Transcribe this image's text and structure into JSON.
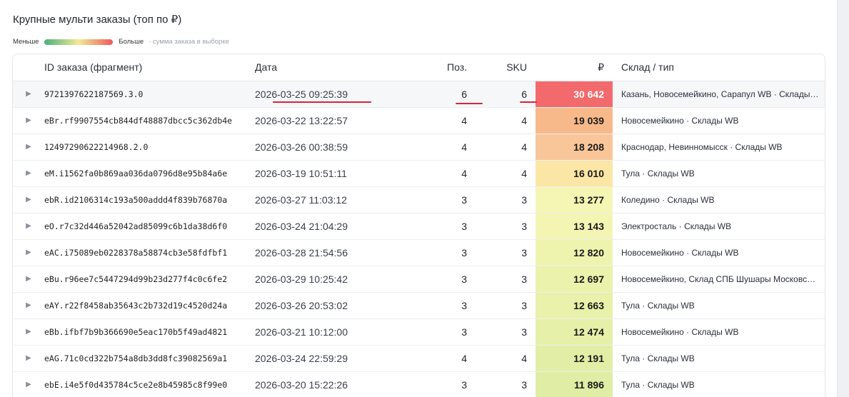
{
  "title": "Крупные мульти заказы (топ по ₽)",
  "legend": {
    "less": "Меньше",
    "more": "Больше",
    "hint": "· сумма заказа в выборке",
    "gradient_from": "#4caf7d",
    "gradient_mid": "#f2ea95",
    "gradient_to": "#ee5a5a"
  },
  "columns": {
    "id": "ID заказа (фрагмент)",
    "date": "Дата",
    "pos": "Поз.",
    "sku": "SKU",
    "rub": "₽",
    "warehouse": "Склад / тип"
  },
  "icons": {
    "expand": "play-triangle-icon"
  },
  "rows": [
    {
      "id": "9721397622187569.3.0",
      "date": "2026-03-25 09:25:39",
      "pos": "6",
      "sku": "6",
      "rub": "30 642",
      "warehouse": "Казань, Новосемейкино, Сарапул WB · Склады WB",
      "color": "#f36a6d"
    },
    {
      "id": "eBr.rf9907554cb844df48887dbcc5c362db4e",
      "date": "2026-03-22 13:22:57",
      "pos": "4",
      "sku": "4",
      "rub": "19 039",
      "warehouse": "Новосемейкино · Склады WB",
      "color": "#f7b989"
    },
    {
      "id": "12497290622214968.2.0",
      "date": "2026-03-26 00:38:59",
      "pos": "4",
      "sku": "4",
      "rub": "18 208",
      "warehouse": "Краснодар, Невинномысск · Склады WB",
      "color": "#f8c699"
    },
    {
      "id": "eM.i1562fa0b869aa036da0796d8e95b84a6e",
      "date": "2026-03-19 10:51:11",
      "pos": "4",
      "sku": "4",
      "rub": "16 010",
      "warehouse": "Тула · Склады WB",
      "color": "#fbe6a6"
    },
    {
      "id": "ebR.id2106314c193a500addd4f839b76870a",
      "date": "2026-03-27 11:03:12",
      "pos": "3",
      "sku": "3",
      "rub": "13 277",
      "warehouse": "Коледино · Склады WB",
      "color": "#f5f6b4"
    },
    {
      "id": "eO.r7c32d446a52042ad85099c6b1da38d6f0",
      "date": "2026-03-24 21:04:29",
      "pos": "3",
      "sku": "3",
      "rub": "13 143",
      "warehouse": "Электросталь · Склады WB",
      "color": "#f4f5b2"
    },
    {
      "id": "eAC.i75089eb0228378a58874cb3e58fdfbf1",
      "date": "2026-03-28 21:54:56",
      "pos": "3",
      "sku": "3",
      "rub": "12 820",
      "warehouse": "Новосемейкино · Склады WB",
      "color": "#eef4ae"
    },
    {
      "id": "eBu.r96ee7c5447294d99b23d277f4c0c6fe2",
      "date": "2026-03-29 10:25:42",
      "pos": "3",
      "sku": "3",
      "rub": "12 697",
      "warehouse": "Новосемейкино, Склад СПБ Шушары Московское",
      "color": "#ebf2ab"
    },
    {
      "id": "eAY.r22f8458ab35643c2b732d19c4520d24a",
      "date": "2026-03-26 20:53:02",
      "pos": "3",
      "sku": "3",
      "rub": "12 663",
      "warehouse": "Тула · Склады WB",
      "color": "#e9f1aa"
    },
    {
      "id": "eBb.ifbf7b9b366690e5eac170b5f49ad4821",
      "date": "2026-03-21 10:12:00",
      "pos": "3",
      "sku": "3",
      "rub": "12 474",
      "warehouse": "Новосемейкино · Склады WB",
      "color": "#e6f0a8"
    },
    {
      "id": "eAG.71c0cd322b754a8db3dd8fc39082569a1",
      "date": "2026-03-24 22:59:29",
      "pos": "4",
      "sku": "4",
      "rub": "12 191",
      "warehouse": "Тула · Склады WB",
      "color": "#e2eea6"
    },
    {
      "id": "ebE.i4e5f0d435784c5ce2e8b45985c8f99e0",
      "date": "2026-03-20 15:22:26",
      "pos": "3",
      "sku": "3",
      "rub": "11 896",
      "warehouse": "Тула · Склады WB",
      "color": "#dfeda5"
    }
  ]
}
